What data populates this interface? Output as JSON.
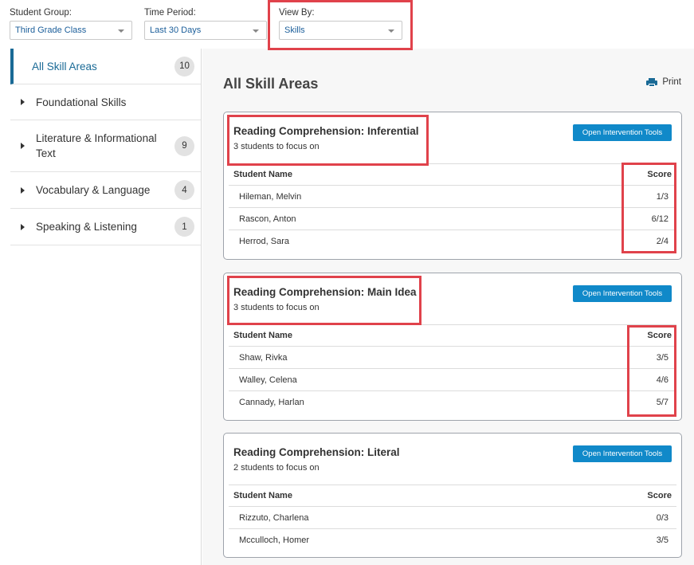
{
  "filters": {
    "student_group": {
      "label": "Student Group:",
      "value": "Third Grade Class"
    },
    "time_period": {
      "label": "Time Period:",
      "value": "Last 30 Days"
    },
    "view_by": {
      "label": "View By:",
      "value": "Skills"
    }
  },
  "sidebar": {
    "items": [
      {
        "label": "All Skill Areas",
        "count": "10"
      },
      {
        "label": "Foundational Skills",
        "count": ""
      },
      {
        "label": "Literature & Informational Text",
        "count": "9"
      },
      {
        "label": "Vocabulary & Language",
        "count": "4"
      },
      {
        "label": "Speaking & Listening",
        "count": "1"
      }
    ]
  },
  "main": {
    "title": "All Skill Areas",
    "print_label": "Print",
    "table_headers": {
      "name": "Student Name",
      "score": "Score"
    },
    "button_label": "Open Intervention Tools",
    "cards": [
      {
        "title": "Reading Comprehension: Inferential",
        "subtitle": "3 students to focus on",
        "rows": [
          {
            "name": "Hileman, Melvin",
            "score": "1/3"
          },
          {
            "name": "Rascon, Anton",
            "score": "6/12"
          },
          {
            "name": "Herrod, Sara",
            "score": "2/4"
          }
        ]
      },
      {
        "title": "Reading Comprehension: Main Idea",
        "subtitle": "3 students to focus on",
        "rows": [
          {
            "name": "Shaw, Rivka",
            "score": "3/5"
          },
          {
            "name": "Walley, Celena",
            "score": "4/6"
          },
          {
            "name": "Cannady, Harlan",
            "score": "5/7"
          }
        ]
      },
      {
        "title": "Reading Comprehension: Literal",
        "subtitle": "2 students to focus on",
        "rows": [
          {
            "name": "Rizzuto, Charlena",
            "score": "0/3"
          },
          {
            "name": "Mcculloch, Homer",
            "score": "3/5"
          }
        ]
      }
    ]
  },
  "colors": {
    "accent": "#1a6a96",
    "button": "#1089c9",
    "highlight": "#e0424b"
  }
}
